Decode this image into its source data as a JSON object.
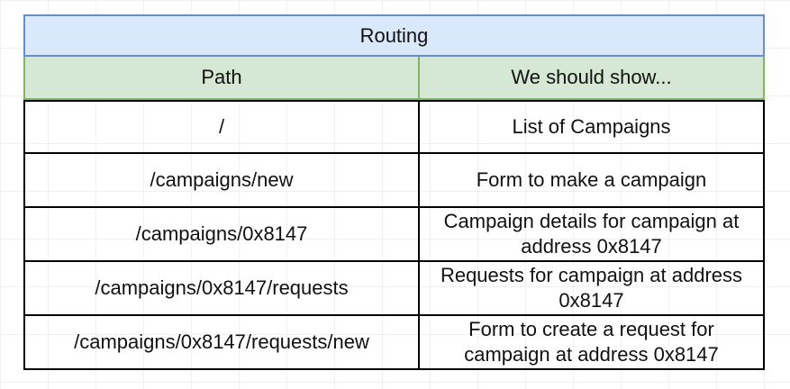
{
  "title": "Routing",
  "headers": [
    "Path",
    "We should show..."
  ],
  "rows": [
    {
      "path": "/",
      "show": "List of Campaigns"
    },
    {
      "path": "/campaigns/new",
      "show": "Form to make a campaign"
    },
    {
      "path": "/campaigns/0x8147",
      "show": "Campaign details for campaign at address 0x8147"
    },
    {
      "path": "/campaigns/0x8147/requests",
      "show": "Requests for campaign at address 0x8147"
    },
    {
      "path": "/campaigns/0x8147/requests/new",
      "show": "Form to create a request for campaign at address 0x8147"
    }
  ]
}
